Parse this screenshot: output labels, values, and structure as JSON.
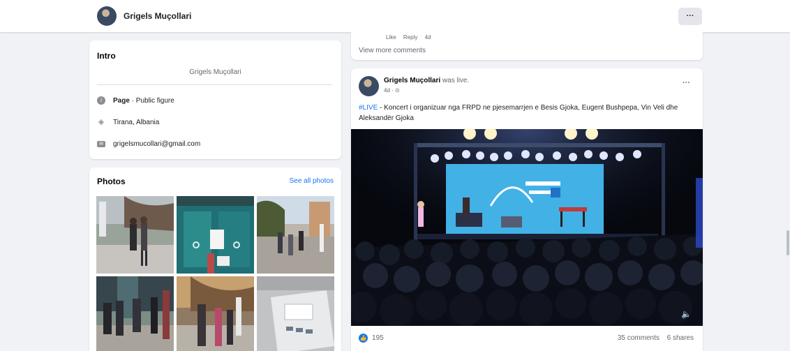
{
  "header": {
    "profile_name": "Grigels Muçollari",
    "more_label": "···"
  },
  "intro": {
    "heading": "Intro",
    "bio": "Grigels Muçollari",
    "page_label": "Page",
    "page_category": " · Public figure",
    "location": "Tirana, Albania",
    "email": "grigelsmucollari@gmail.com"
  },
  "photos": {
    "heading": "Photos",
    "see_all": "See all photos"
  },
  "comments": {
    "like": "Like",
    "reply": "Reply",
    "time": "4d",
    "view_more": "View more comments"
  },
  "post": {
    "author": "Grigels Muçollari",
    "status": " was live.",
    "time": "4d · ⊙",
    "more_label": "···",
    "hashtag": "#LIVE",
    "text": " - Koncert i organizuar nga FRPD ne pjesemarrjen e Besis Gjoka, Eugent Bushpepa, Vin Veli dhe Aleksandër Gjoka",
    "reactions_count": "195",
    "comments_count": "35 comments",
    "shares_count": "6 shares"
  },
  "colors": {
    "accent": "#1877f2",
    "background": "#f0f2f5",
    "card": "#ffffff",
    "secondary_text": "#65676b"
  },
  "icons": {
    "page": "info-icon",
    "location": "map-pin-icon",
    "email": "mail-icon",
    "reaction": "like-icon",
    "volume": "speaker-icon"
  }
}
